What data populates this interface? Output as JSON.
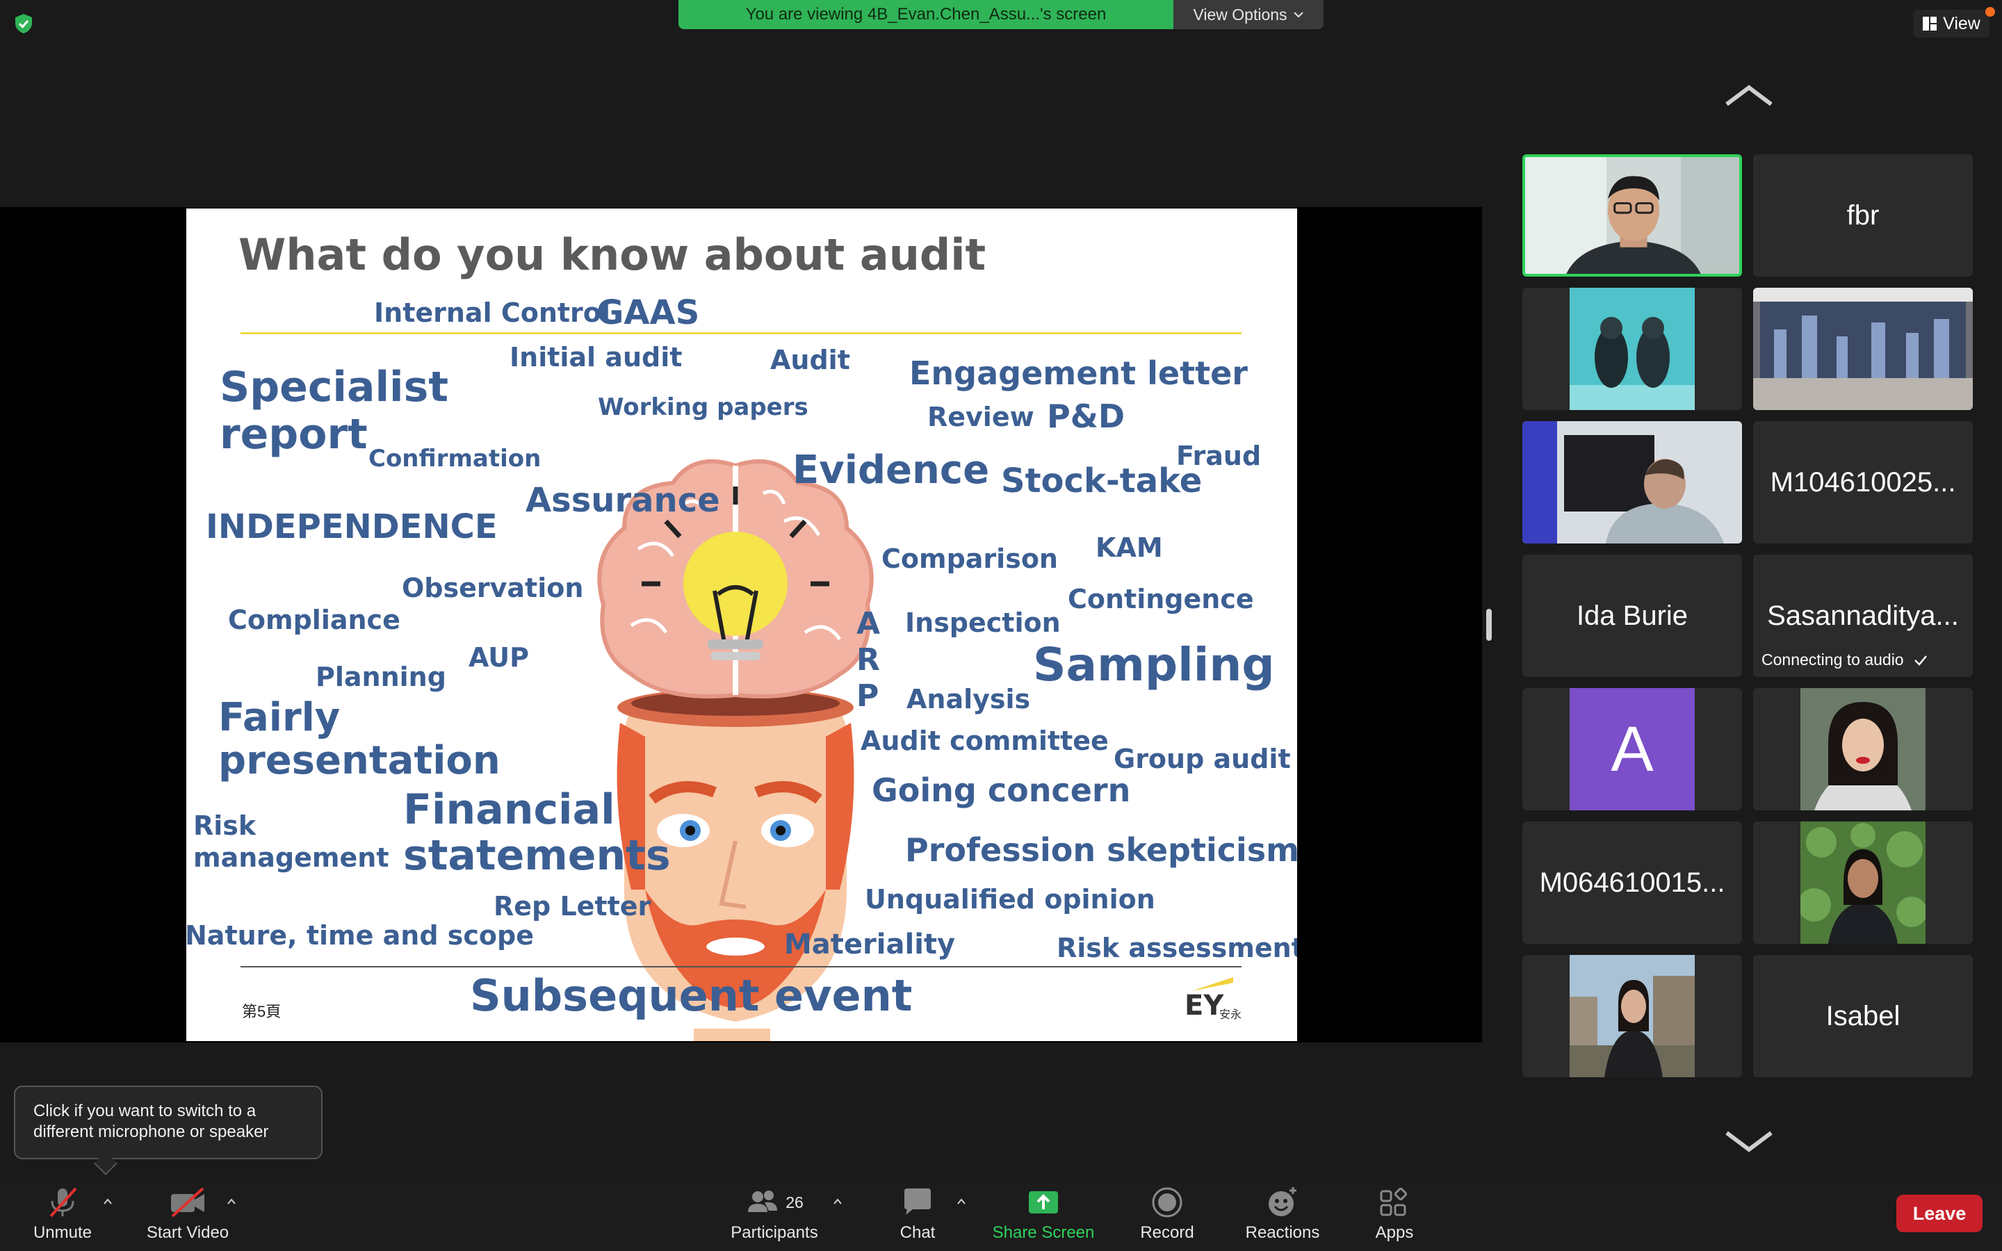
{
  "banner": {
    "text": "You are viewing 4B_Evan.Chen_Assu...'s screen",
    "view_options": "View Options"
  },
  "view_button": "View",
  "slide": {
    "title": "What do you know about audit",
    "page_number": "第5頁",
    "logo_text": "EY",
    "logo_sub": "安永",
    "words": [
      {
        "text": "Internal Control"
      },
      {
        "text": "GAAS"
      },
      {
        "text": "Initial audit"
      },
      {
        "text": "Audit"
      },
      {
        "text": "Engagement letter"
      },
      {
        "text": "Specialist"
      },
      {
        "text": "report"
      },
      {
        "text": "Working papers"
      },
      {
        "text": "Review"
      },
      {
        "text": "P&D"
      },
      {
        "text": "Confirmation"
      },
      {
        "text": "Fraud"
      },
      {
        "text": "Evidence"
      },
      {
        "text": "Stock-take"
      },
      {
        "text": "Assurance"
      },
      {
        "text": "INDEPENDENCE"
      },
      {
        "text": "Comparison"
      },
      {
        "text": "KAM"
      },
      {
        "text": "Observation"
      },
      {
        "text": "Compliance"
      },
      {
        "text": "Contingence"
      },
      {
        "text": "A"
      },
      {
        "text": "R"
      },
      {
        "text": "P"
      },
      {
        "text": "Inspection"
      },
      {
        "text": "AUP"
      },
      {
        "text": "Planning"
      },
      {
        "text": "Sampling"
      },
      {
        "text": "Analysis"
      },
      {
        "text": "Fairly"
      },
      {
        "text": "presentation"
      },
      {
        "text": "Audit committee"
      },
      {
        "text": "Group audit"
      },
      {
        "text": "Financial"
      },
      {
        "text": "statements"
      },
      {
        "text": "Going concern"
      },
      {
        "text": "Risk"
      },
      {
        "text": "management"
      },
      {
        "text": "Profession skepticism"
      },
      {
        "text": "Rep Letter"
      },
      {
        "text": "Unqualified opinion"
      },
      {
        "text": "Nature, time and scope"
      },
      {
        "text": "Materiality"
      },
      {
        "text": "Risk assessment"
      },
      {
        "text": "Subsequent event"
      }
    ]
  },
  "gallery": {
    "tiles": [
      {
        "name": "",
        "kind": "video-man-glasses"
      },
      {
        "name": "fbr",
        "kind": "name"
      },
      {
        "name": "",
        "kind": "video-underwater"
      },
      {
        "name": "",
        "kind": "video-room"
      },
      {
        "name": "",
        "kind": "video-man-blurred"
      },
      {
        "name": "M104610025...",
        "kind": "name"
      },
      {
        "name": "Ida Burie",
        "kind": "name"
      },
      {
        "name": "Sasannaditya...",
        "kind": "name",
        "status": "Connecting to audio"
      },
      {
        "name": "A",
        "kind": "avatar"
      },
      {
        "name": "",
        "kind": "video-woman-red-lips"
      },
      {
        "name": "M064610015...",
        "kind": "name"
      },
      {
        "name": "",
        "kind": "video-woman-plants"
      },
      {
        "name": "",
        "kind": "video-woman-city"
      },
      {
        "name": "Isabel",
        "kind": "name"
      }
    ]
  },
  "tooltip": "Click if you want to switch to a different microphone or speaker",
  "toolbar": {
    "unmute": "Unmute",
    "start_video": "Start Video",
    "participants": "Participants",
    "participant_count": "26",
    "chat": "Chat",
    "share_screen": "Share Screen",
    "record": "Record",
    "reactions": "Reactions",
    "apps": "Apps",
    "leave": "Leave"
  },
  "colors": {
    "banner": "#2fb457",
    "word": "#3c5f93",
    "leave": "#c8202a",
    "active_speaker": "#2fd35a",
    "avatar": "#7b4fc9"
  }
}
